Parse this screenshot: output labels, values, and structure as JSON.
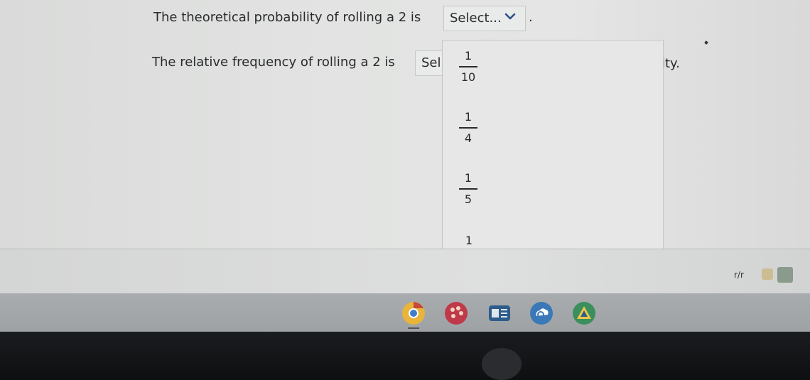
{
  "question": {
    "line1_prefix": "The theoretical probability of rolling a 2 is",
    "line1_select_value": "Select...",
    "line1_suffix": ".",
    "line2_prefix": "The relative frequency of rolling a 2 is",
    "line2_select_value": "Sel",
    "line2_suffix": "lity."
  },
  "dropdown": {
    "options": [
      {
        "num": "1",
        "den": "10"
      },
      {
        "num": "1",
        "den": "4"
      },
      {
        "num": "1",
        "den": "5"
      },
      {
        "whole": "1"
      }
    ]
  },
  "tray": {
    "text": "r/r"
  },
  "shelf_apps": [
    "chrome-icon",
    "art-app-icon",
    "classroom-icon",
    "cloud-sync-icon",
    "drive-app-icon"
  ],
  "colors": {
    "chrome_blue": "#3f7ec9",
    "chrome_yellow": "#e8b43a",
    "art_red": "#c0394b",
    "classroom_blue": "#2e5c8a",
    "sync_blue": "#3b78b8",
    "drive_green": "#3a8f5c"
  }
}
